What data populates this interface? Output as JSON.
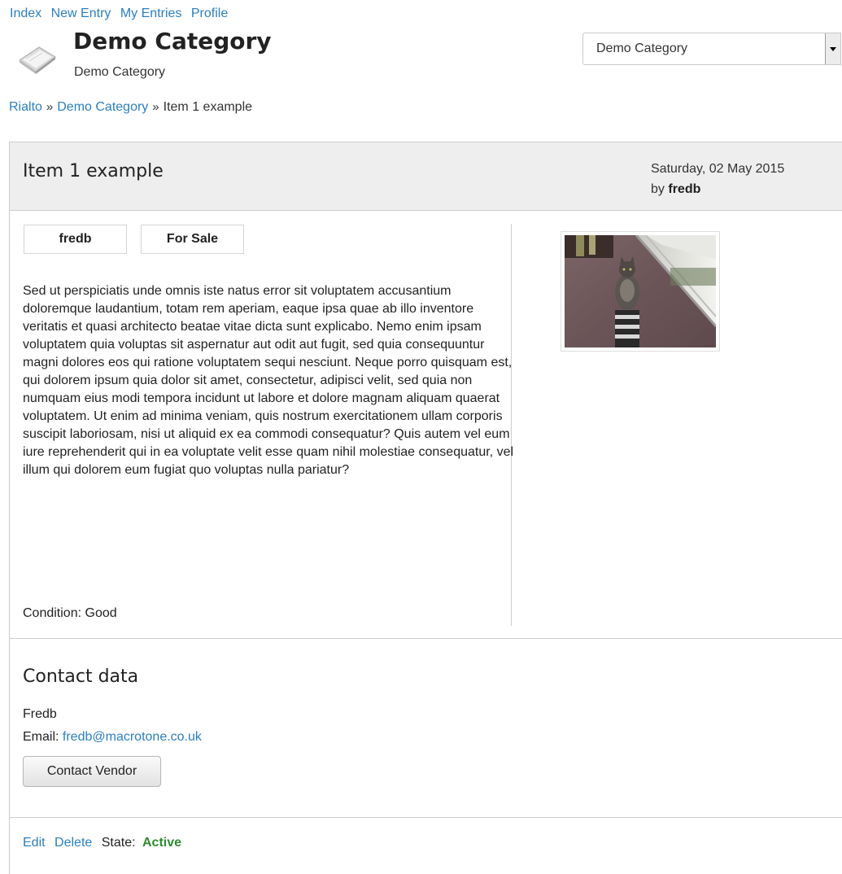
{
  "top_nav": {
    "items": [
      "Index",
      "New Entry",
      "My Entries",
      "Profile"
    ]
  },
  "category": {
    "icon": "book-icon",
    "title": "Demo Category",
    "subtitle": "Demo Category",
    "select": {
      "selected": "Demo Category",
      "arrow": "▾"
    }
  },
  "breadcrumb": {
    "items": [
      "Rialto",
      "Demo Category",
      "Item 1 example"
    ],
    "separator": "»"
  },
  "item": {
    "title": "Item 1 example",
    "date": "Saturday, 02 May 2015",
    "by_prefix": "by",
    "author": "fredb",
    "tags": [
      "fredb",
      "For Sale"
    ],
    "description": "Sed ut perspiciatis unde omnis iste natus error sit voluptatem accusantium doloremque laudantium, totam rem aperiam, eaque ipsa quae ab illo inventore veritatis et quasi architecto beatae vitae dicta sunt explicabo. Nemo enim ipsam voluptatem quia voluptas sit aspernatur aut odit aut fugit, sed quia consequuntur magni dolores eos qui ratione voluptatem sequi nesciunt. Neque porro quisquam est, qui dolorem ipsum quia dolor sit amet, consectetur, adipisci velit, sed quia non numquam eius modi tempora incidunt ut labore et dolore magnam aliquam quaerat voluptatem. Ut enim ad minima veniam, quis nostrum exercitationem ullam corporis suscipit laboriosam, nisi ut aliquid ex ea commodi consequatur? Quis autem vel eum iure reprehenderit qui in ea voluptate velit esse quam nihil molestiae consequatur, vel illum qui dolorem eum fugiat quo voluptas nulla pariatur?",
    "condition": "Condition: Good",
    "photo": "cat-photo"
  },
  "contact": {
    "title": "Contact data",
    "name": "Fredb",
    "email_label": "Email:",
    "email": "fredb@macrotone.co.uk",
    "button": "Contact Vendor"
  },
  "actions": {
    "edit": "Edit",
    "delete": "Delete",
    "state_label": "State:",
    "state_value": "Active"
  },
  "colors": {
    "link": "#2a7fc0",
    "header_bg": "#eeeeee",
    "active_state": "#2e8b2e"
  }
}
